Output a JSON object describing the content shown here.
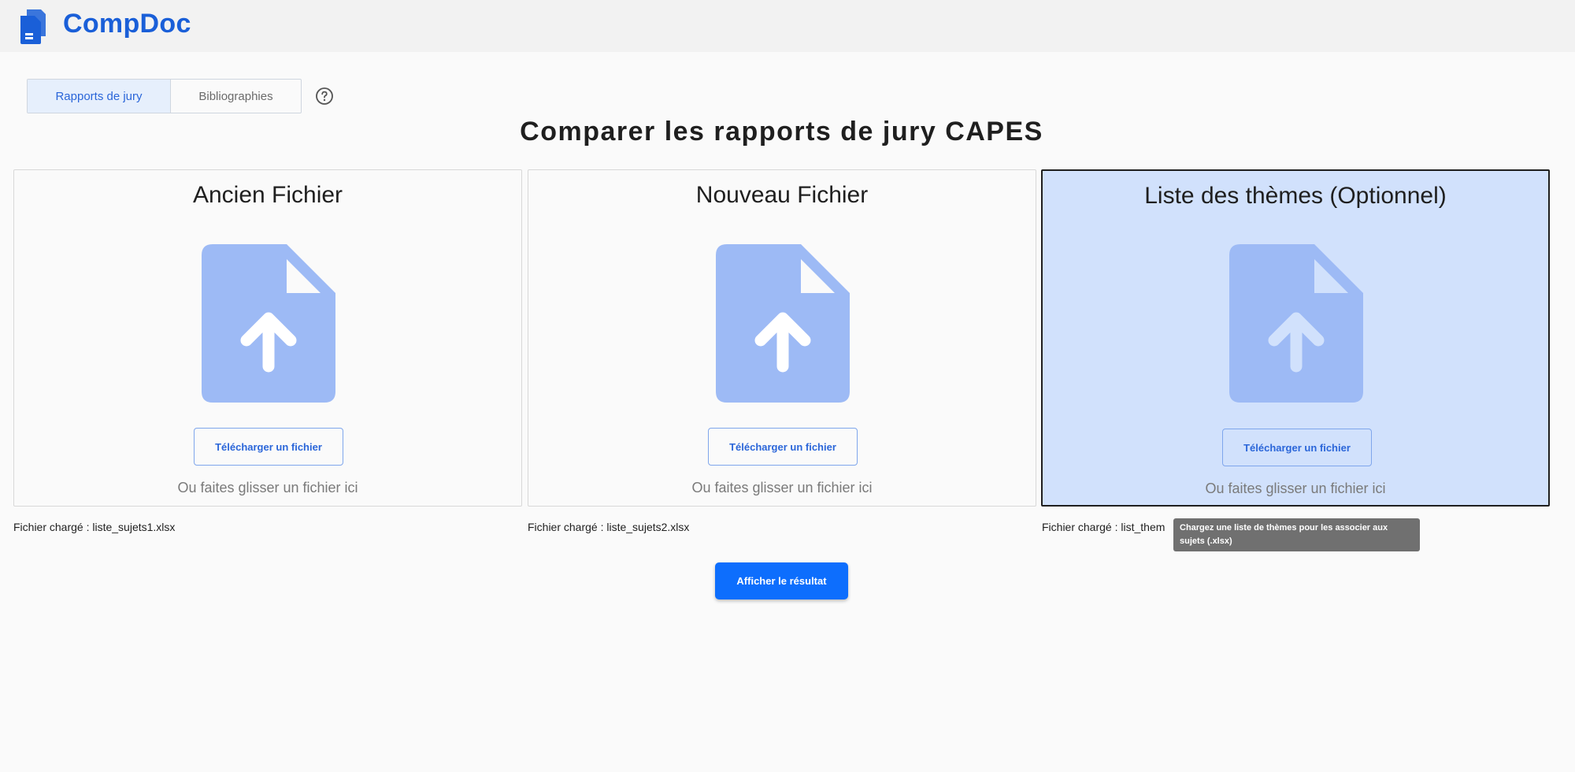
{
  "app": {
    "name": "CompDoc",
    "brand_color": "#1a5fd8",
    "logo_icon": "document-stack-icon"
  },
  "tabs": [
    {
      "label": "Rapports de jury",
      "active": true
    },
    {
      "label": "Bibliographies",
      "active": false
    }
  ],
  "help": {
    "icon": "help-circle-icon"
  },
  "page": {
    "title": "Comparer les rapports de jury CAPES"
  },
  "cards": [
    {
      "title": "Ancien Fichier",
      "icon": "file-upload-icon",
      "button_label": "Télécharger un fichier",
      "drop_hint": "Ou faites glisser un fichier ici",
      "loaded_text": "Fichier chargé : liste_sujets1.xlsx",
      "highlighted": false
    },
    {
      "title": "Nouveau Fichier",
      "icon": "file-upload-icon",
      "button_label": "Télécharger un fichier",
      "drop_hint": "Ou faites glisser un fichier ici",
      "loaded_text": "Fichier chargé : liste_sujets2.xlsx",
      "highlighted": false
    },
    {
      "title": "Liste des thèmes (Optionnel)",
      "icon": "file-upload-icon",
      "button_label": "Télécharger un fichier",
      "drop_hint": "Ou faites glisser un fichier ici",
      "loaded_text": "Fichier chargé : list_them",
      "highlighted": true
    }
  ],
  "tooltip": {
    "text": "Chargez une liste de thèmes pour les associer aux sujets (.xlsx)"
  },
  "actions": {
    "show_result_label": "Afficher le résultat"
  },
  "colors": {
    "accent": "#0d6efd",
    "icon_fill": "#9dbaf5",
    "highlight_bg": "#d1e1fc"
  }
}
